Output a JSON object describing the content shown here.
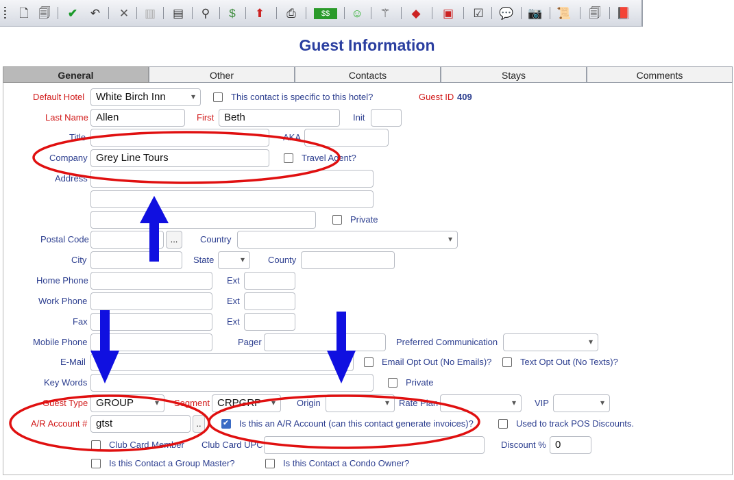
{
  "toolbar": {
    "icons": [
      "new-icon",
      "copy-icon",
      "save-check-icon",
      "undo-icon",
      "delete-icon",
      "merge-icon",
      "report-icon",
      "search-icon",
      "money-icon",
      "export-icon",
      "print-icon",
      "cash-icon",
      "smiley-icon",
      "wand-icon",
      "eraser-icon",
      "folder-icon",
      "checklist-icon",
      "comment-icon",
      "camera-icon",
      "scroll-icon",
      "documents-icon",
      "book-icon"
    ]
  },
  "page_title": "Guest Information",
  "tabs": [
    {
      "label": "General",
      "active": true
    },
    {
      "label": "Other"
    },
    {
      "label": "Contacts"
    },
    {
      "label": "Stays"
    },
    {
      "label": "Comments"
    }
  ],
  "form": {
    "default_hotel": {
      "label": "Default Hotel",
      "value": "White Birch Inn"
    },
    "specific_hotel": {
      "label": "This contact is specific to this hotel?"
    },
    "guest_id": {
      "label": "Guest ID",
      "value": "409"
    },
    "last_name": {
      "label": "Last Name",
      "value": "Allen"
    },
    "first": {
      "label": "First",
      "value": "Beth"
    },
    "init": {
      "label": "Init",
      "value": ""
    },
    "title": {
      "label": "Title",
      "value": ""
    },
    "aka": {
      "label": "AKA",
      "value": ""
    },
    "company": {
      "label": "Company",
      "value": "Grey Line Tours"
    },
    "travel_agent": {
      "label": "Travel Agent?"
    },
    "address": {
      "label": "Address",
      "line1": "",
      "line2": "",
      "line3": ""
    },
    "address_private": {
      "label": "Private"
    },
    "postal_code": {
      "label": "Postal Code",
      "value": "",
      "button": "..."
    },
    "country": {
      "label": "Country",
      "value": ""
    },
    "city": {
      "label": "City",
      "value": ""
    },
    "state": {
      "label": "State",
      "value": ""
    },
    "county": {
      "label": "County",
      "value": ""
    },
    "home_phone": {
      "label": "Home Phone",
      "value": "",
      "ext_label": "Ext"
    },
    "work_phone": {
      "label": "Work Phone",
      "value": "",
      "ext_label": "Ext"
    },
    "fax": {
      "label": "Fax",
      "value": "",
      "ext_label": "Ext"
    },
    "mobile_phone": {
      "label": "Mobile Phone",
      "value": ""
    },
    "pager": {
      "label": "Pager",
      "value": ""
    },
    "preferred_communication": {
      "label": "Preferred Communication",
      "value": ""
    },
    "email": {
      "label": "E-Mail",
      "value": ""
    },
    "email_opt_out": {
      "label": "Email Opt Out (No Emails)?"
    },
    "text_opt_out": {
      "label": "Text Opt Out (No Texts)?"
    },
    "key_words": {
      "label": "Key Words",
      "value": ""
    },
    "key_words_private": {
      "label": "Private"
    },
    "guest_type": {
      "label": "Guest Type",
      "value": "GROUP"
    },
    "segment": {
      "label": "Segment",
      "value": "CRPGRP"
    },
    "origin": {
      "label": "Origin",
      "value": ""
    },
    "rate_plan": {
      "label": "Rate Plan",
      "value": ""
    },
    "vip": {
      "label": "VIP",
      "value": ""
    },
    "ar_account": {
      "label": "A/R Account #",
      "value": "gtst",
      "button": ".."
    },
    "is_ar_account": {
      "label": "Is this an A/R Account (can this contact generate invoices)?",
      "checked": true
    },
    "pos_discounts": {
      "label": "Used to track POS Discounts."
    },
    "club_card_member": {
      "label": "Club Card Member"
    },
    "club_card_upc": {
      "label": "Club Card UPC",
      "value": ""
    },
    "discount": {
      "label": "Discount %",
      "value": "0"
    },
    "group_master": {
      "label": "Is this Contact a Group Master?"
    },
    "condo_owner": {
      "label": "Is this Contact a Condo Owner?"
    }
  },
  "colors": {
    "annotation_ellipse": "#e01010",
    "annotation_arrow": "#1010e0",
    "required_label": "#d11a1a",
    "label": "#2c3e8f",
    "title": "#2b3fa0"
  }
}
